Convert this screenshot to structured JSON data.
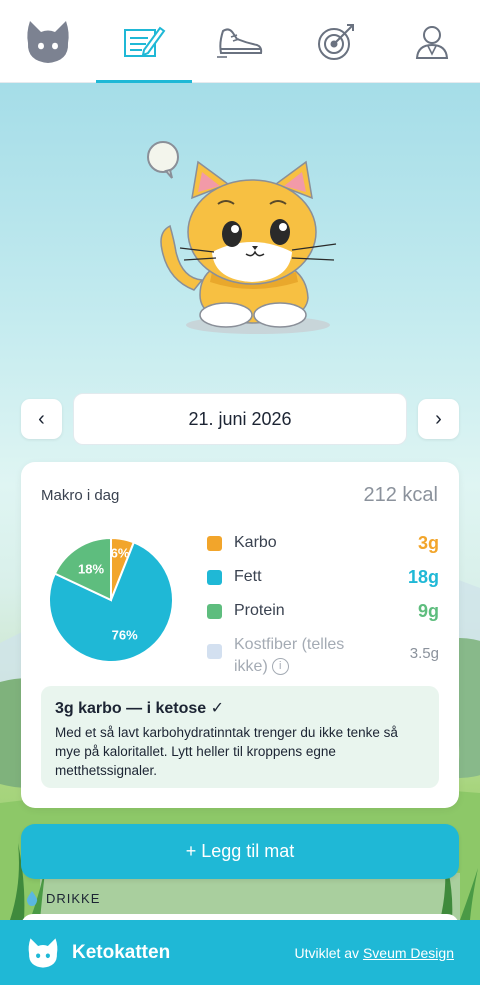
{
  "nav": {
    "tabs": [
      {
        "icon": "cat-logo-icon",
        "active": false
      },
      {
        "icon": "food-diary-icon",
        "active": true
      },
      {
        "icon": "sneaker-icon",
        "active": false
      },
      {
        "icon": "target-icon",
        "active": false
      },
      {
        "icon": "profile-icon",
        "active": false
      }
    ]
  },
  "date": {
    "label": "21. juni 2026",
    "prev": "‹",
    "next": "›"
  },
  "macros": {
    "title": "Makro i dag",
    "kcal": "212 kcal",
    "items": [
      {
        "name": "Karbo",
        "value": "3g",
        "color": "#f2a52b"
      },
      {
        "name": "Fett",
        "value": "18g",
        "color": "#1fb8d6"
      },
      {
        "name": "Protein",
        "value": "9g",
        "color": "#5ebd7e"
      }
    ],
    "fiber": {
      "name": "Kostfiber (telles ikke)",
      "value": "3.5g",
      "color": "#d3e0f0",
      "info": "i"
    }
  },
  "chart_data": {
    "type": "pie",
    "slices": [
      {
        "label": "Karbo",
        "percent": 6,
        "color": "#f2a52b"
      },
      {
        "label": "Fett",
        "percent": 76,
        "color": "#1fb8d6"
      },
      {
        "label": "Protein",
        "percent": 18,
        "color": "#5ebd7e"
      }
    ],
    "labels": [
      "6%",
      "76%",
      "18%"
    ]
  },
  "keto": {
    "title": "3g karbo — i ketose ✓",
    "text": "Med et så lavt karbohydratinntak trenger du ikke tenke så mye på kaloritallet. Lytt heller til kroppens egne metthetssignaler."
  },
  "actions": {
    "add_food": "+ Legg til mat",
    "drink_label": "DRIKKE"
  },
  "footer": {
    "brand": "Ketokatten",
    "credit_prefix": "Utviklet av",
    "credit_link": "Sveum Design"
  }
}
